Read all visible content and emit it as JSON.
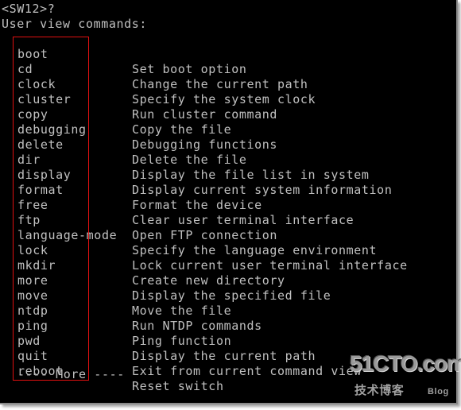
{
  "terminal": {
    "prompt": "<SW12>?",
    "header": "User view commands:",
    "commands": [
      {
        "name": "boot",
        "desc": "Set boot option"
      },
      {
        "name": "cd",
        "desc": "Change the current path"
      },
      {
        "name": "clock",
        "desc": "Specify the system clock"
      },
      {
        "name": "cluster",
        "desc": "Run cluster command"
      },
      {
        "name": "copy",
        "desc": "Copy the file"
      },
      {
        "name": "debugging",
        "desc": "Debugging functions"
      },
      {
        "name": "delete",
        "desc": "Delete the file"
      },
      {
        "name": "dir",
        "desc": "Display the file list in system"
      },
      {
        "name": "display",
        "desc": "Display current system information"
      },
      {
        "name": "format",
        "desc": "Format the device"
      },
      {
        "name": "free",
        "desc": "Clear user terminal interface"
      },
      {
        "name": "ftp",
        "desc": "Open FTP connection"
      },
      {
        "name": "language-mode",
        "desc": "Specify the language environment"
      },
      {
        "name": "lock",
        "desc": "Lock current user terminal interface"
      },
      {
        "name": "mkdir",
        "desc": "Create new directory"
      },
      {
        "name": "more",
        "desc": "Display the specified file"
      },
      {
        "name": "move",
        "desc": "Move the file"
      },
      {
        "name": "ntdp",
        "desc": "Run NTDP commands"
      },
      {
        "name": "ping",
        "desc": "Ping function"
      },
      {
        "name": "pwd",
        "desc": "Display the current path"
      },
      {
        "name": "quit",
        "desc": "Exit from current command view"
      },
      {
        "name": "reboot",
        "desc": "Reset switch"
      }
    ],
    "more_prompt": "---- More ----"
  },
  "watermark": {
    "brand": "51CTO.com",
    "subtitle": "技术博客",
    "blog": "Blog"
  },
  "colors": {
    "background": "#000000",
    "text": "#c0c0c0",
    "highlight_border": "#e01010"
  }
}
